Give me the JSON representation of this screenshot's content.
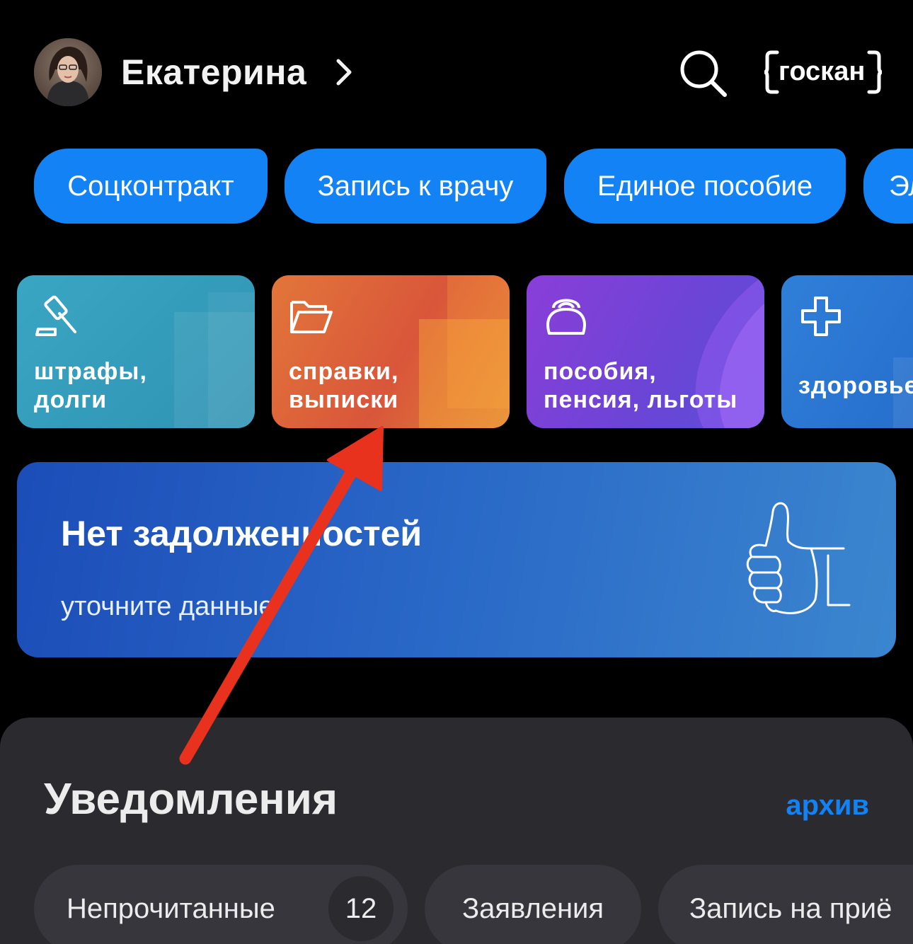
{
  "header": {
    "user_name": "Екатерина",
    "scan_label": "госкан"
  },
  "chips": [
    {
      "label": "Соцконтракт"
    },
    {
      "label": "Запись к врачу"
    },
    {
      "label": "Единое пособие"
    },
    {
      "label": "Эл"
    }
  ],
  "categories": [
    {
      "label_line1": "штрафы,",
      "label_line2": "долги",
      "icon": "gavel-icon"
    },
    {
      "label_line1": "справки,",
      "label_line2": "выписки",
      "icon": "folder-icon"
    },
    {
      "label_line1": "пособия,",
      "label_line2": "пенсия, льготы",
      "icon": "purse-icon"
    },
    {
      "label_line1": "здоровье",
      "label_line2": "",
      "icon": "plus-cross-icon"
    }
  ],
  "banner": {
    "title": "Нет задолженностей",
    "subtitle": "уточните данные",
    "icon": "thumbs-up-icon"
  },
  "notifications": {
    "title": "Уведомления",
    "archive_label": "архив",
    "filters": [
      {
        "label": "Непрочитанные",
        "count": "12"
      },
      {
        "label": "Заявления"
      },
      {
        "label": "Запись на приё"
      }
    ]
  },
  "colors": {
    "accent": "#1282f5",
    "annotation_arrow": "#e8321e"
  }
}
